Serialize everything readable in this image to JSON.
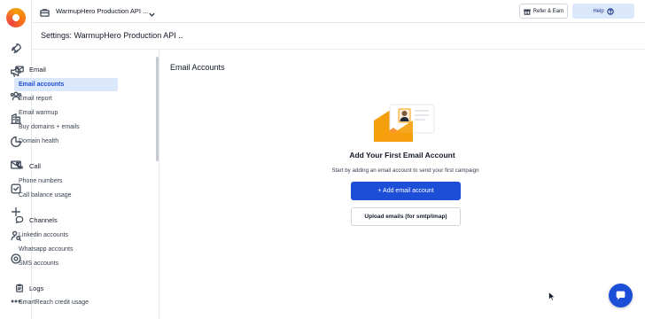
{
  "topbar": {
    "workspace_name": "WarmupHero Production API ...",
    "refer_label": "Refer & Earn",
    "help_label": "Help"
  },
  "settings_title": "Settings: WarmupHero Production API ..",
  "rail": {
    "icons": [
      "rocket-icon",
      "megaphone-icon",
      "users-icon",
      "building-icon",
      "pie-chart-icon",
      "mail-icon",
      "checkbox-icon",
      "plus-icon",
      "user-search-icon",
      "settings-icon",
      "more-icon"
    ]
  },
  "sidebar": {
    "groups": [
      {
        "heading": "Email",
        "icon": "mail-icon",
        "items": [
          "Email accounts",
          "Email report",
          "Email warmup",
          "Buy domains + emails",
          "Domain health"
        ]
      },
      {
        "heading": "Call",
        "icon": "phone-icon",
        "items": [
          "Phone numbers",
          "Call balance usage"
        ]
      },
      {
        "heading": "Channels",
        "icon": "chat-icon",
        "items": [
          "Linkedin accounts",
          "Whatsapp accounts",
          "SMS accounts"
        ]
      },
      {
        "heading": "Logs",
        "icon": "clipboard-icon",
        "items": [
          "SmartReach credit usage"
        ]
      }
    ],
    "active_item": "Email accounts"
  },
  "main": {
    "title": "Email Accounts",
    "empty_title": "Add Your First Email Account",
    "empty_description": "Start by adding an email account to send your first campaign",
    "add_button_label": "+ Add email account",
    "upload_button_label": "Upload emails (for smtp/imap)"
  },
  "colors": {
    "primary": "#1d4ed8",
    "active_bg": "#dbe7fb",
    "envelope_orange": "#f59e0b"
  }
}
